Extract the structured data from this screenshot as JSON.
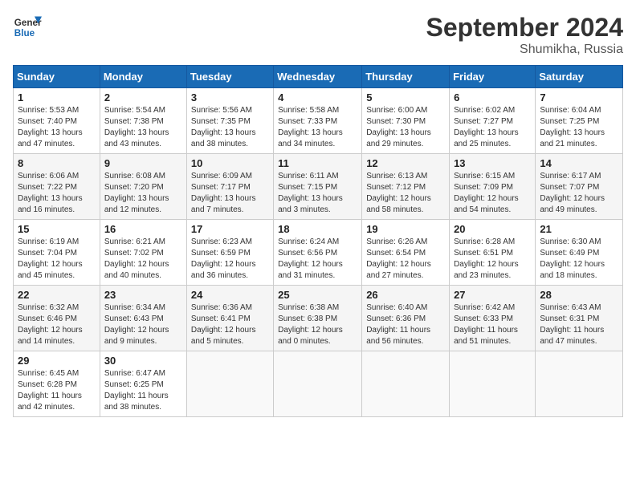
{
  "header": {
    "logo_line1": "General",
    "logo_line2": "Blue",
    "month_title": "September 2024",
    "subtitle": "Shumikha, Russia"
  },
  "days_of_week": [
    "Sunday",
    "Monday",
    "Tuesday",
    "Wednesday",
    "Thursday",
    "Friday",
    "Saturday"
  ],
  "weeks": [
    [
      {
        "day": "1",
        "info": "Sunrise: 5:53 AM\nSunset: 7:40 PM\nDaylight: 13 hours\nand 47 minutes."
      },
      {
        "day": "2",
        "info": "Sunrise: 5:54 AM\nSunset: 7:38 PM\nDaylight: 13 hours\nand 43 minutes."
      },
      {
        "day": "3",
        "info": "Sunrise: 5:56 AM\nSunset: 7:35 PM\nDaylight: 13 hours\nand 38 minutes."
      },
      {
        "day": "4",
        "info": "Sunrise: 5:58 AM\nSunset: 7:33 PM\nDaylight: 13 hours\nand 34 minutes."
      },
      {
        "day": "5",
        "info": "Sunrise: 6:00 AM\nSunset: 7:30 PM\nDaylight: 13 hours\nand 29 minutes."
      },
      {
        "day": "6",
        "info": "Sunrise: 6:02 AM\nSunset: 7:27 PM\nDaylight: 13 hours\nand 25 minutes."
      },
      {
        "day": "7",
        "info": "Sunrise: 6:04 AM\nSunset: 7:25 PM\nDaylight: 13 hours\nand 21 minutes."
      }
    ],
    [
      {
        "day": "8",
        "info": "Sunrise: 6:06 AM\nSunset: 7:22 PM\nDaylight: 13 hours\nand 16 minutes."
      },
      {
        "day": "9",
        "info": "Sunrise: 6:08 AM\nSunset: 7:20 PM\nDaylight: 13 hours\nand 12 minutes."
      },
      {
        "day": "10",
        "info": "Sunrise: 6:09 AM\nSunset: 7:17 PM\nDaylight: 13 hours\nand 7 minutes."
      },
      {
        "day": "11",
        "info": "Sunrise: 6:11 AM\nSunset: 7:15 PM\nDaylight: 13 hours\nand 3 minutes."
      },
      {
        "day": "12",
        "info": "Sunrise: 6:13 AM\nSunset: 7:12 PM\nDaylight: 12 hours\nand 58 minutes."
      },
      {
        "day": "13",
        "info": "Sunrise: 6:15 AM\nSunset: 7:09 PM\nDaylight: 12 hours\nand 54 minutes."
      },
      {
        "day": "14",
        "info": "Sunrise: 6:17 AM\nSunset: 7:07 PM\nDaylight: 12 hours\nand 49 minutes."
      }
    ],
    [
      {
        "day": "15",
        "info": "Sunrise: 6:19 AM\nSunset: 7:04 PM\nDaylight: 12 hours\nand 45 minutes."
      },
      {
        "day": "16",
        "info": "Sunrise: 6:21 AM\nSunset: 7:02 PM\nDaylight: 12 hours\nand 40 minutes."
      },
      {
        "day": "17",
        "info": "Sunrise: 6:23 AM\nSunset: 6:59 PM\nDaylight: 12 hours\nand 36 minutes."
      },
      {
        "day": "18",
        "info": "Sunrise: 6:24 AM\nSunset: 6:56 PM\nDaylight: 12 hours\nand 31 minutes."
      },
      {
        "day": "19",
        "info": "Sunrise: 6:26 AM\nSunset: 6:54 PM\nDaylight: 12 hours\nand 27 minutes."
      },
      {
        "day": "20",
        "info": "Sunrise: 6:28 AM\nSunset: 6:51 PM\nDaylight: 12 hours\nand 23 minutes."
      },
      {
        "day": "21",
        "info": "Sunrise: 6:30 AM\nSunset: 6:49 PM\nDaylight: 12 hours\nand 18 minutes."
      }
    ],
    [
      {
        "day": "22",
        "info": "Sunrise: 6:32 AM\nSunset: 6:46 PM\nDaylight: 12 hours\nand 14 minutes."
      },
      {
        "day": "23",
        "info": "Sunrise: 6:34 AM\nSunset: 6:43 PM\nDaylight: 12 hours\nand 9 minutes."
      },
      {
        "day": "24",
        "info": "Sunrise: 6:36 AM\nSunset: 6:41 PM\nDaylight: 12 hours\nand 5 minutes."
      },
      {
        "day": "25",
        "info": "Sunrise: 6:38 AM\nSunset: 6:38 PM\nDaylight: 12 hours\nand 0 minutes."
      },
      {
        "day": "26",
        "info": "Sunrise: 6:40 AM\nSunset: 6:36 PM\nDaylight: 11 hours\nand 56 minutes."
      },
      {
        "day": "27",
        "info": "Sunrise: 6:42 AM\nSunset: 6:33 PM\nDaylight: 11 hours\nand 51 minutes."
      },
      {
        "day": "28",
        "info": "Sunrise: 6:43 AM\nSunset: 6:31 PM\nDaylight: 11 hours\nand 47 minutes."
      }
    ],
    [
      {
        "day": "29",
        "info": "Sunrise: 6:45 AM\nSunset: 6:28 PM\nDaylight: 11 hours\nand 42 minutes."
      },
      {
        "day": "30",
        "info": "Sunrise: 6:47 AM\nSunset: 6:25 PM\nDaylight: 11 hours\nand 38 minutes."
      },
      {
        "day": "",
        "info": ""
      },
      {
        "day": "",
        "info": ""
      },
      {
        "day": "",
        "info": ""
      },
      {
        "day": "",
        "info": ""
      },
      {
        "day": "",
        "info": ""
      }
    ]
  ]
}
